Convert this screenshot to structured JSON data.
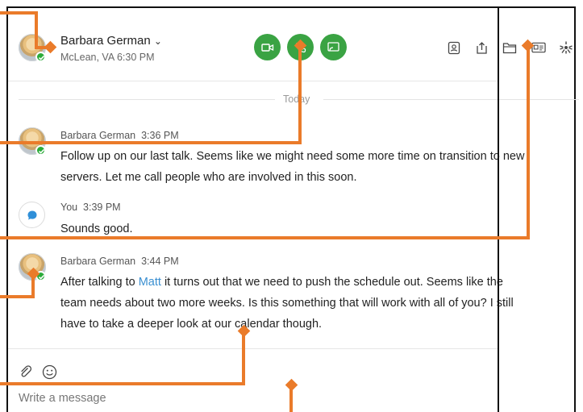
{
  "header": {
    "contact_name": "Barbara German",
    "location_time": "McLean, VA 6:30 PM"
  },
  "divider_label": "Today",
  "messages": [
    {
      "sender": "Barbara German",
      "time": "3:36 PM",
      "lines": [
        "Follow up on our last talk. Seems like we might need some more time on transition to new",
        "servers. Let me call people who are involved in this soon."
      ]
    },
    {
      "sender": "You",
      "time": "3:39 PM",
      "lines": [
        "Sounds good."
      ]
    },
    {
      "sender": "Barbara German",
      "time": "3:44 PM",
      "line1_pre": "After talking to ",
      "mention": "Matt",
      "line1_post": " it turns out that we need to push the schedule out. Seems like the",
      "line2": "team needs about two more weeks. Is this something that will work with all of you? I still",
      "line3": "have to take a deeper look at our calendar though."
    }
  ],
  "composer": {
    "placeholder": "Write a message"
  },
  "colors": {
    "call_green": "#3aa343",
    "presence_green": "#2bab3a",
    "callout_orange": "#ea7b2a",
    "mention_blue": "#3a8fd1"
  },
  "icons": {
    "video": "video-camera-icon",
    "phone": "phone-icon",
    "share": "screen-share-icon",
    "contact": "contact-card-icon",
    "upload": "upload-icon",
    "folder": "folder-icon",
    "id": "id-card-icon",
    "apps": "apps-icon",
    "attach": "paperclip-icon",
    "emoji": "emoji-icon"
  }
}
